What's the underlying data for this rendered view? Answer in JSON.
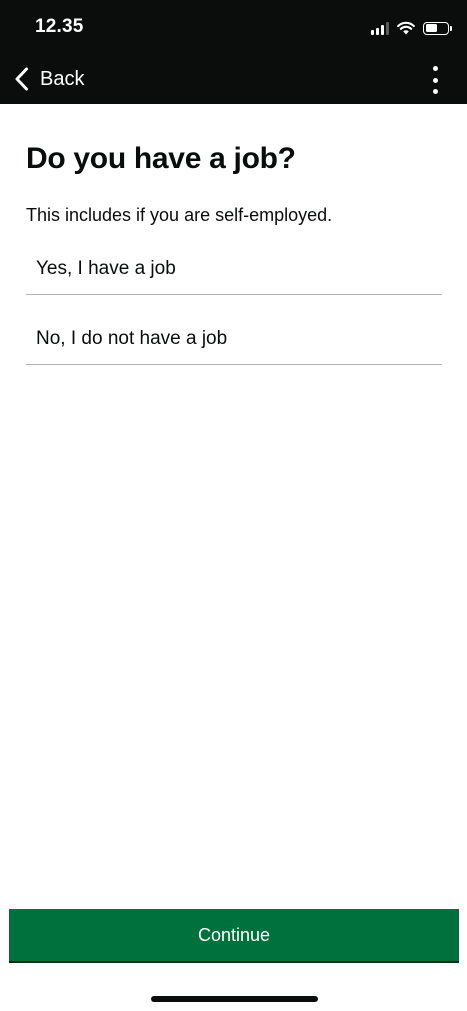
{
  "status_bar": {
    "time": "12.35",
    "signal_level": "3 of 4 bars",
    "battery_level": 0.55
  },
  "app_bar": {
    "back_label": "Back",
    "back_icon": "chevron-left-icon",
    "menu_icon": "vertical-ellipsis-icon"
  },
  "main": {
    "title": "Do you have a job?",
    "hint": "This includes if you are self-employed.",
    "options": [
      {
        "label": "Yes, I have a job"
      },
      {
        "label": "No, I do not have a job"
      }
    ]
  },
  "footer": {
    "continue_label": "Continue"
  },
  "colors": {
    "topbar": "#0b0c0c",
    "text": "#0b0c0c",
    "divider": "#b1b4b6",
    "continue_button": "#00703c"
  }
}
